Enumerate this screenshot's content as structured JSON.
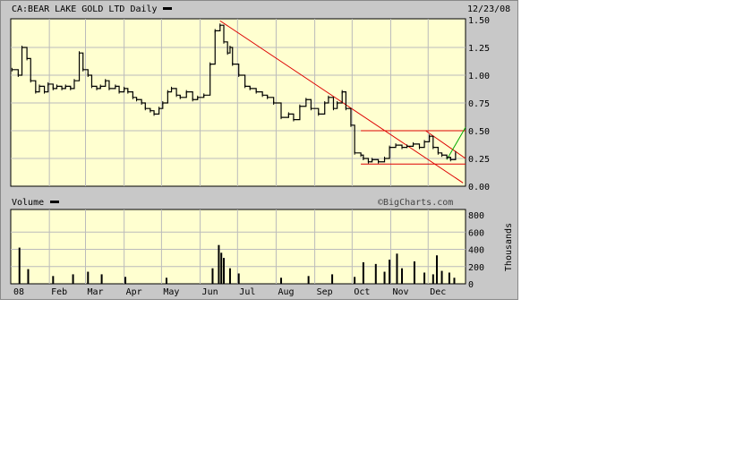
{
  "chart_data": [
    {
      "type": "line",
      "title": "CA:BEAR LAKE GOLD LTD Daily",
      "date": "12/23/08",
      "ylim": [
        0,
        1.5
      ],
      "yticks": [
        "1.50",
        "1.25",
        "1.00",
        "0.75",
        "0.50",
        "0.25",
        "0.00"
      ],
      "xticks": [
        "08",
        "Feb",
        "Mar",
        "Apr",
        "May",
        "Jun",
        "Jul",
        "Aug",
        "Sep",
        "Oct",
        "Nov",
        "Dec"
      ],
      "grid": true,
      "x": [
        "2008-01-02",
        "2008-01-07",
        "2008-01-10",
        "2008-01-14",
        "2008-01-17",
        "2008-01-21",
        "2008-01-24",
        "2008-01-28",
        "2008-01-31",
        "2008-02-04",
        "2008-02-07",
        "2008-02-11",
        "2008-02-14",
        "2008-02-18",
        "2008-02-21",
        "2008-02-25",
        "2008-02-28",
        "2008-03-03",
        "2008-03-06",
        "2008-03-10",
        "2008-03-13",
        "2008-03-17",
        "2008-03-20",
        "2008-03-25",
        "2008-03-28",
        "2008-04-01",
        "2008-04-04",
        "2008-04-08",
        "2008-04-11",
        "2008-04-15",
        "2008-04-18",
        "2008-04-22",
        "2008-04-25",
        "2008-04-29",
        "2008-05-02",
        "2008-05-06",
        "2008-05-09",
        "2008-05-13",
        "2008-05-16",
        "2008-05-21",
        "2008-05-26",
        "2008-05-30",
        "2008-06-04",
        "2008-06-09",
        "2008-06-13",
        "2008-06-17",
        "2008-06-20",
        "2008-06-23",
        "2008-06-25",
        "2008-06-27",
        "2008-07-02",
        "2008-07-07",
        "2008-07-11",
        "2008-07-16",
        "2008-07-21",
        "2008-07-25",
        "2008-07-30",
        "2008-08-05",
        "2008-08-11",
        "2008-08-15",
        "2008-08-20",
        "2008-08-25",
        "2008-08-29",
        "2008-09-04",
        "2008-09-09",
        "2008-09-12",
        "2008-09-16",
        "2008-09-19",
        "2008-09-23",
        "2008-09-26",
        "2008-09-30",
        "2008-10-03",
        "2008-10-08",
        "2008-10-10",
        "2008-10-14",
        "2008-10-17",
        "2008-10-22",
        "2008-10-27",
        "2008-10-31",
        "2008-11-05",
        "2008-11-10",
        "2008-11-14",
        "2008-11-19",
        "2008-11-24",
        "2008-11-28",
        "2008-12-02",
        "2008-12-05",
        "2008-12-09",
        "2008-12-12",
        "2008-12-16",
        "2008-12-19",
        "2008-12-23"
      ],
      "series": [
        {
          "values": [
            1.05,
            1.0,
            1.25,
            1.15,
            0.95,
            0.85,
            0.9,
            0.85,
            0.92,
            0.88,
            0.9,
            0.88,
            0.9,
            0.88,
            0.95,
            1.2,
            1.05,
            1.0,
            0.9,
            0.88,
            0.9,
            0.95,
            0.88,
            0.9,
            0.85,
            0.88,
            0.85,
            0.8,
            0.78,
            0.75,
            0.7,
            0.68,
            0.65,
            0.7,
            0.75,
            0.85,
            0.88,
            0.82,
            0.8,
            0.85,
            0.78,
            0.8,
            0.82,
            1.1,
            1.4,
            1.45,
            1.3,
            1.2,
            1.25,
            1.1,
            1.0,
            0.9,
            0.88,
            0.85,
            0.82,
            0.8,
            0.75,
            0.62,
            0.65,
            0.6,
            0.72,
            0.78,
            0.7,
            0.65,
            0.75,
            0.8,
            0.7,
            0.75,
            0.85,
            0.7,
            0.55,
            0.3,
            0.28,
            0.25,
            0.22,
            0.24,
            0.22,
            0.25,
            0.35,
            0.37,
            0.35,
            0.36,
            0.38,
            0.35,
            0.4,
            0.45,
            0.35,
            0.3,
            0.28,
            0.26,
            0.24,
            0.3
          ]
        }
      ],
      "trendlines": [
        {
          "x": [
            "2008-06-17",
            "2008-12-29"
          ],
          "values": [
            1.49,
            0.03
          ],
          "color": "#dd0000"
        },
        {
          "x": [
            "2008-10-08",
            "2008-12-31"
          ],
          "values": [
            0.5,
            0.5
          ],
          "color": "#dd0000"
        },
        {
          "x": [
            "2008-10-08",
            "2008-12-31"
          ],
          "values": [
            0.2,
            0.2
          ],
          "color": "#dd0000"
        },
        {
          "x": [
            "2008-11-29",
            "2008-12-31"
          ],
          "values": [
            0.5,
            0.25
          ],
          "color": "#dd0000"
        },
        {
          "x": [
            "2008-12-16",
            "2008-12-31"
          ],
          "values": [
            0.24,
            0.53
          ],
          "color": "#00aa00"
        }
      ]
    },
    {
      "type": "bar",
      "title": "Volume",
      "ylabel": "Thousands",
      "ylim": [
        0,
        800
      ],
      "yticks": [
        "800",
        "600",
        "400",
        "200",
        "0"
      ],
      "watermark": "©BigCharts.com",
      "x": [
        "2008-01-08",
        "2008-01-15",
        "2008-02-04",
        "2008-02-20",
        "2008-03-03",
        "2008-03-14",
        "2008-04-02",
        "2008-05-05",
        "2008-06-11",
        "2008-06-16",
        "2008-06-18",
        "2008-06-20",
        "2008-06-25",
        "2008-07-02",
        "2008-08-05",
        "2008-08-27",
        "2008-09-15",
        "2008-10-03",
        "2008-10-10",
        "2008-10-20",
        "2008-10-27",
        "2008-10-31",
        "2008-11-06",
        "2008-11-10",
        "2008-11-20",
        "2008-11-28",
        "2008-12-05",
        "2008-12-08",
        "2008-12-12",
        "2008-12-18",
        "2008-12-22"
      ],
      "values": [
        420,
        170,
        90,
        110,
        140,
        110,
        80,
        70,
        180,
        450,
        360,
        300,
        180,
        120,
        70,
        90,
        110,
        80,
        250,
        230,
        140,
        280,
        350,
        180,
        260,
        130,
        110,
        330,
        150,
        130,
        70
      ]
    }
  ]
}
